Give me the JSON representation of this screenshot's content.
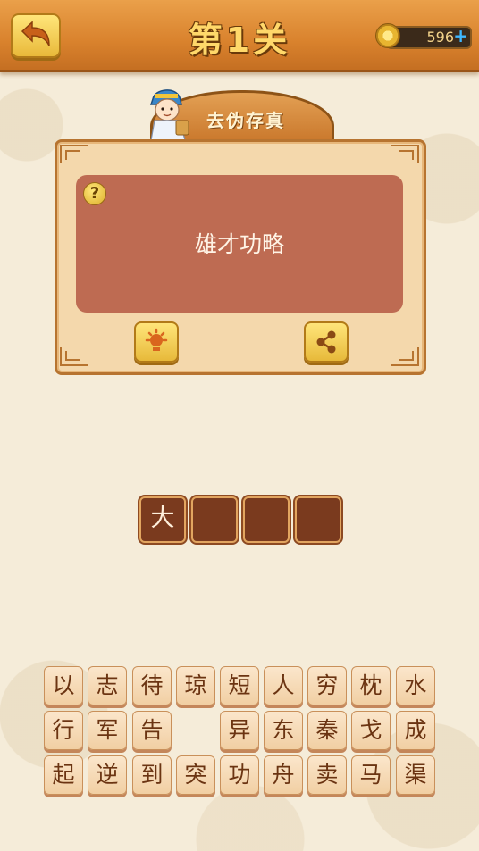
{
  "header": {
    "level_title": "第1关",
    "coins": "596",
    "coin_add": "+"
  },
  "question": {
    "category": "去伪存真",
    "clue": "雄才功略",
    "help_symbol": "?"
  },
  "answer": {
    "slots": [
      "大",
      "",
      "",
      ""
    ]
  },
  "letters": {
    "row1": [
      "以",
      "志",
      "待",
      "琼",
      "短",
      "人",
      "穷",
      "枕",
      "水"
    ],
    "row2": [
      "行",
      "军",
      "告",
      "",
      "异",
      "东",
      "秦",
      "戈",
      "成"
    ],
    "row3": [
      "起",
      "逆",
      "到",
      "突",
      "功",
      "舟",
      "卖",
      "马",
      "渠"
    ]
  },
  "colors": {
    "header": "#d9822d",
    "panel": "#be6b52",
    "tile": "#f4d8ac",
    "answer_slot": "#7a3a1e"
  }
}
